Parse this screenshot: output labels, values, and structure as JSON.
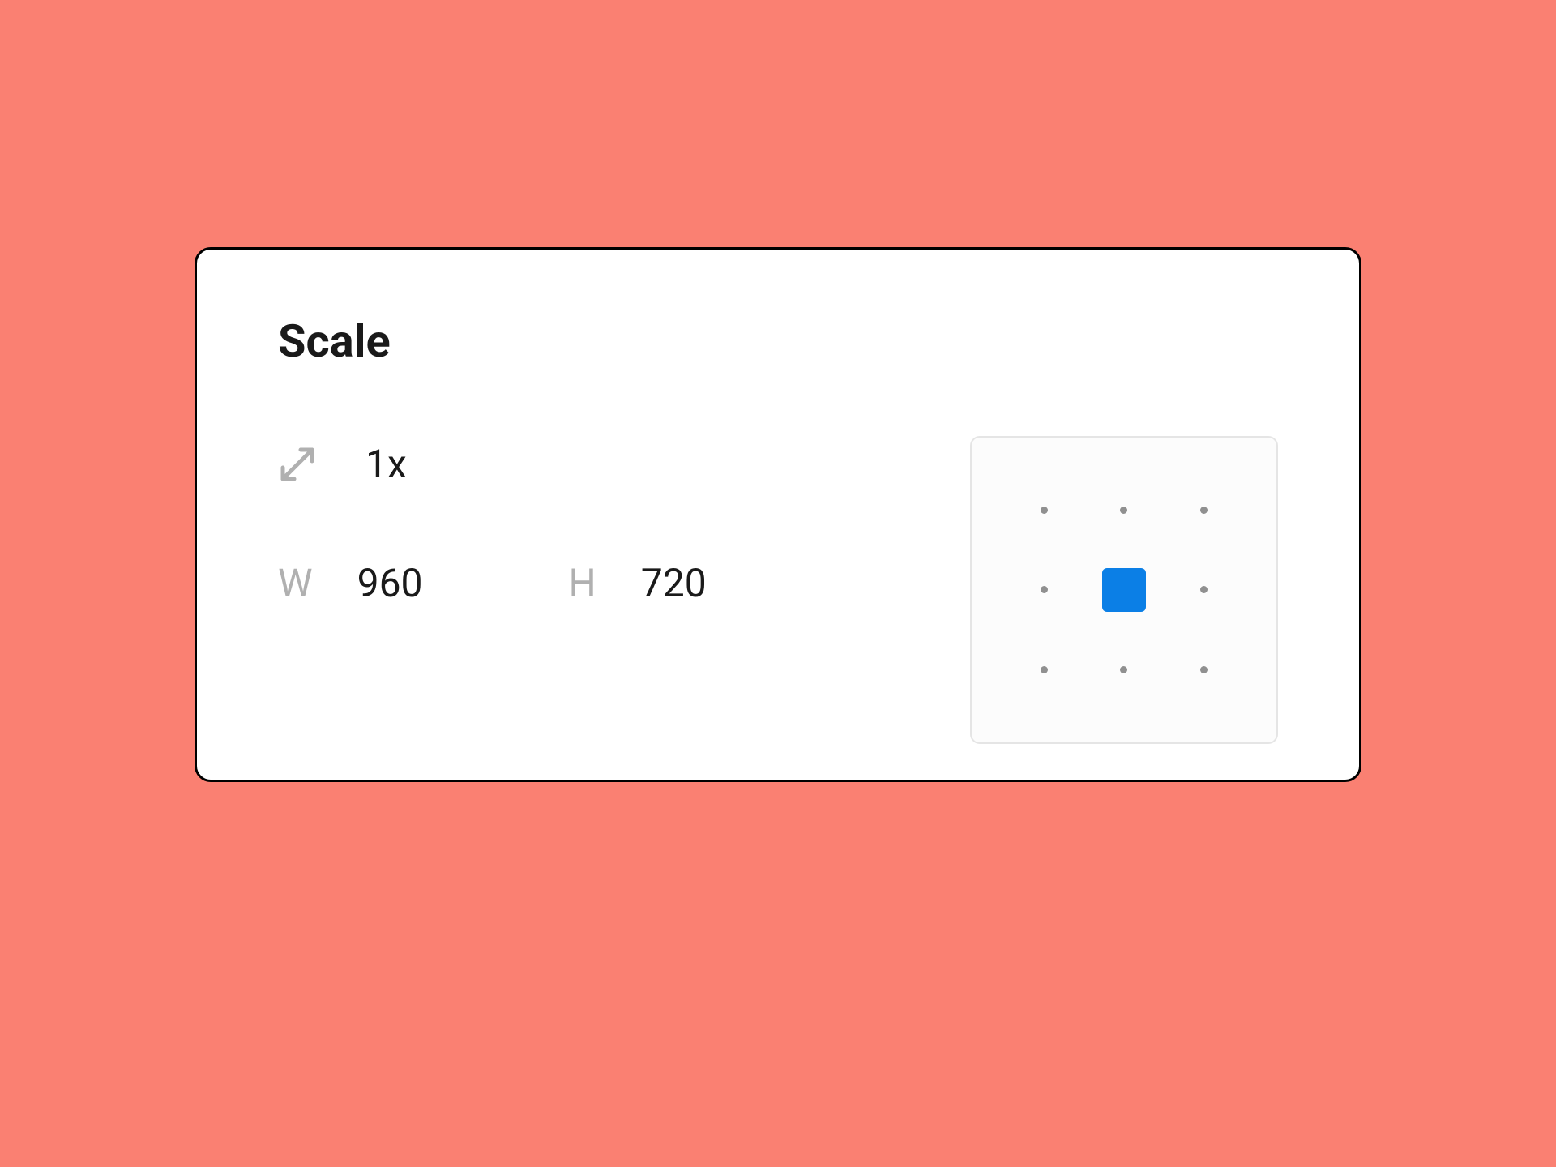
{
  "panel": {
    "title": "Scale",
    "scale": {
      "value": "1x",
      "icon": "scale-diagonal-icon"
    },
    "dimensions": {
      "width": {
        "label": "W",
        "value": "960"
      },
      "height": {
        "label": "H",
        "value": "720"
      }
    },
    "anchor": {
      "selected_index": 4,
      "grid_size": 9
    }
  },
  "colors": {
    "background": "#FA8072",
    "panel_bg": "#FFFFFF",
    "panel_border": "#000000",
    "text_primary": "#1a1a1a",
    "text_muted": "#b0b0b0",
    "anchor_selected": "#0b7fe6",
    "anchor_dot": "#909090",
    "anchor_bg": "#fcfcfc",
    "anchor_border": "#e5e5e5"
  }
}
